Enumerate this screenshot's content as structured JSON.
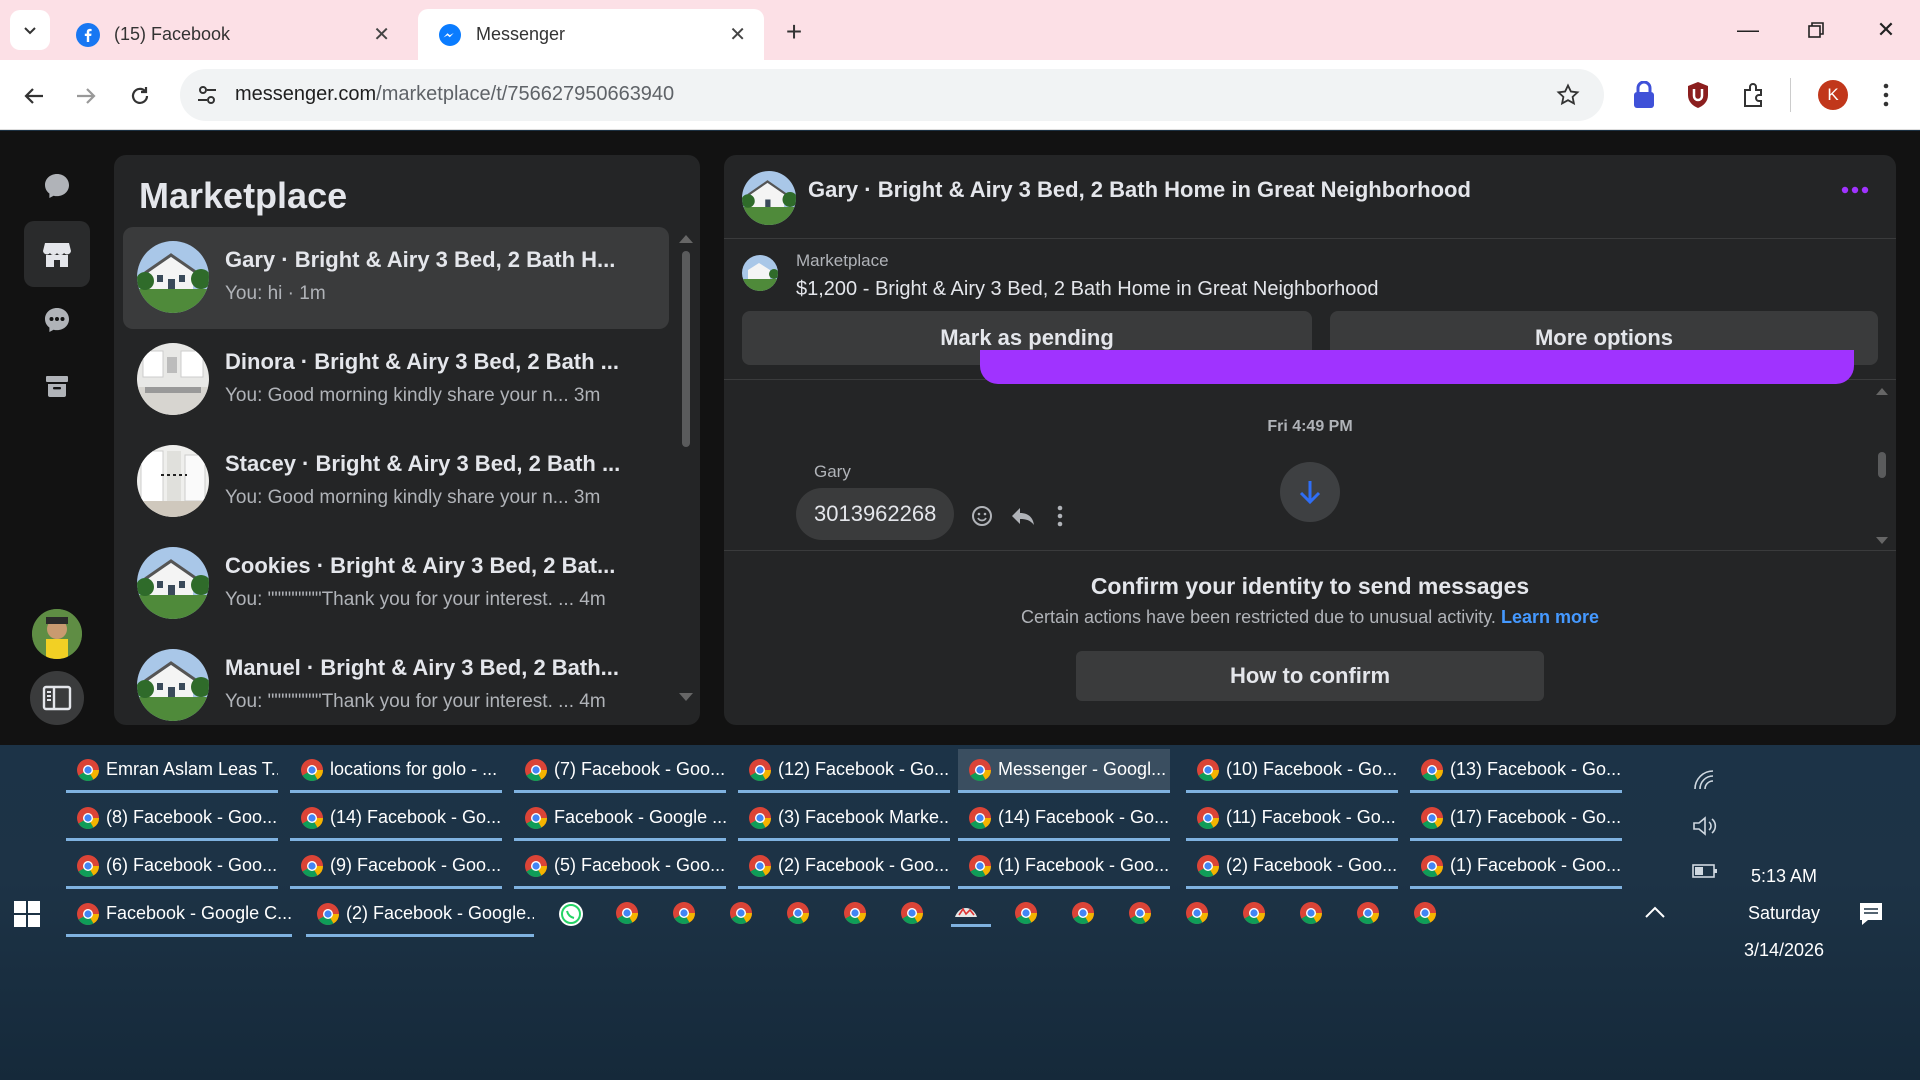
{
  "browser": {
    "tabs": [
      {
        "label": "(15) Facebook",
        "icon": "facebook-icon"
      },
      {
        "label": "Messenger",
        "icon": "messenger-icon"
      }
    ],
    "url_host": "messenger.com",
    "url_path": "/marketplace/t/756627950663940",
    "profile_initial": "K"
  },
  "marketplace": {
    "title": "Marketplace",
    "conversations": [
      {
        "name": "Gary · Bright & Airy 3 Bed, 2 Bath H...",
        "preview": "You: hi · 1m",
        "selected": true
      },
      {
        "name": "Dinora · Bright & Airy 3 Bed, 2 Bath ...",
        "preview": "You: Good morning kindly share your n...  3m"
      },
      {
        "name": "Stacey · Bright & Airy 3 Bed, 2 Bath ...",
        "preview": "You: Good morning kindly share your n...  3m"
      },
      {
        "name": "Cookies · Bright & Airy 3 Bed, 2 Bat...",
        "preview": "You: \"\"\"\"\"\"\"\"Thank you for your interest. ...  4m"
      },
      {
        "name": "Manuel · Bright & Airy 3 Bed, 2 Bath...",
        "preview": "You: \"\"\"\"\"\"\"\"Thank you for your interest. ...  4m"
      }
    ]
  },
  "chat": {
    "title": "Gary · Bright & Airy 3 Bed, 2 Bath Home in Great Neighborhood",
    "listing_source": "Marketplace",
    "listing_title": "$1,200 - Bright & Airy 3 Bed, 2 Bath Home in Great Neighborhood",
    "mark_pending": "Mark as pending",
    "more_options": "More options",
    "timestamp": "Fri 4:49 PM",
    "sender": "Gary",
    "message": "3013962268",
    "confirm_title": "Confirm your identity to send messages",
    "confirm_desc": "Certain actions have been restricted due to unusual activity.",
    "learn_more": "Learn more",
    "how_to_confirm": "How to confirm"
  },
  "taskbar": {
    "rows": [
      [
        "Emran Aslam Leas T...",
        "locations for golo - ...",
        "(7) Facebook - Goo...",
        "(12) Facebook - Go...",
        "Messenger - Googl...",
        "(10) Facebook - Go...",
        "(13) Facebook - Go..."
      ],
      [
        "(8) Facebook - Goo...",
        "(14) Facebook - Go...",
        "Facebook - Google ...",
        "(3) Facebook Marke...",
        "(14) Facebook - Go...",
        "(11) Facebook - Go...",
        "(17) Facebook - Go..."
      ],
      [
        "(6) Facebook - Goo...",
        "(9) Facebook - Goo...",
        "(5) Facebook - Goo...",
        "(2) Facebook - Goo...",
        "(1) Facebook - Goo...",
        "(2) Facebook - Goo...",
        "(1) Facebook - Goo..."
      ]
    ],
    "active": "Messenger - Googl...",
    "bottom": [
      "Facebook - Google C...",
      "(2) Facebook - Google..."
    ],
    "time": "5:13 AM",
    "day": "Saturday",
    "date": "3/14/2026"
  },
  "colors": {
    "accent_purple": "#a033ff",
    "messenger_blue": "#0a7cff",
    "link_blue": "#4599ff",
    "taskbar_underline": "#7fb2e0"
  }
}
